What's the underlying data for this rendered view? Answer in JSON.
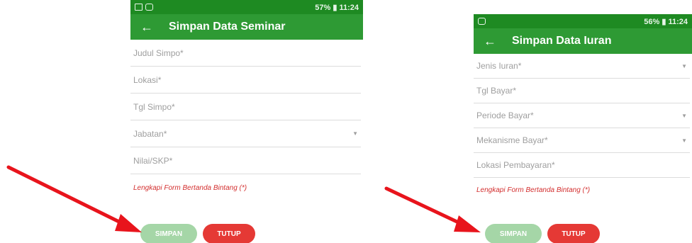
{
  "left": {
    "status": {
      "left_icons": [
        "image-icon",
        "instagram-icon"
      ],
      "right_text": "57% ▮ 11:24"
    },
    "title": "Simpan Data Seminar",
    "fields": [
      {
        "label": "Judul Simpo*",
        "dropdown": false
      },
      {
        "label": "Lokasi*",
        "dropdown": false
      },
      {
        "label": "Tgl Simpo*",
        "dropdown": false
      },
      {
        "label": "Jabatan*",
        "dropdown": true
      },
      {
        "label": "Nilai/SKP*",
        "dropdown": false
      }
    ],
    "warning": "Lengkapi Form Bertanda Bintang (*)",
    "save_label": "SIMPAN",
    "close_label": "TUTUP"
  },
  "right": {
    "status": {
      "left_icons": [
        "instagram-icon"
      ],
      "right_text": "56% ▮ 11:24"
    },
    "title": "Simpan Data Iuran",
    "fields": [
      {
        "label": "Jenis Iuran*",
        "dropdown": true
      },
      {
        "label": "Tgl Bayar*",
        "dropdown": false
      },
      {
        "label": "Periode Bayar*",
        "dropdown": true
      },
      {
        "label": "Mekanisme Bayar*",
        "dropdown": true
      },
      {
        "label": "Lokasi Pembayaran*",
        "dropdown": false
      }
    ],
    "warning": "Lengkapi Form Bertanda Bintang (*)",
    "save_label": "SIMPAN",
    "close_label": "TUTUP"
  },
  "colors": {
    "appbar": "#2e9a34",
    "statusbar": "#1e8a22",
    "save_button": "#a5d6a7",
    "close_button": "#e53935",
    "arrow": "#e8141c",
    "warning": "#d32f2f"
  }
}
